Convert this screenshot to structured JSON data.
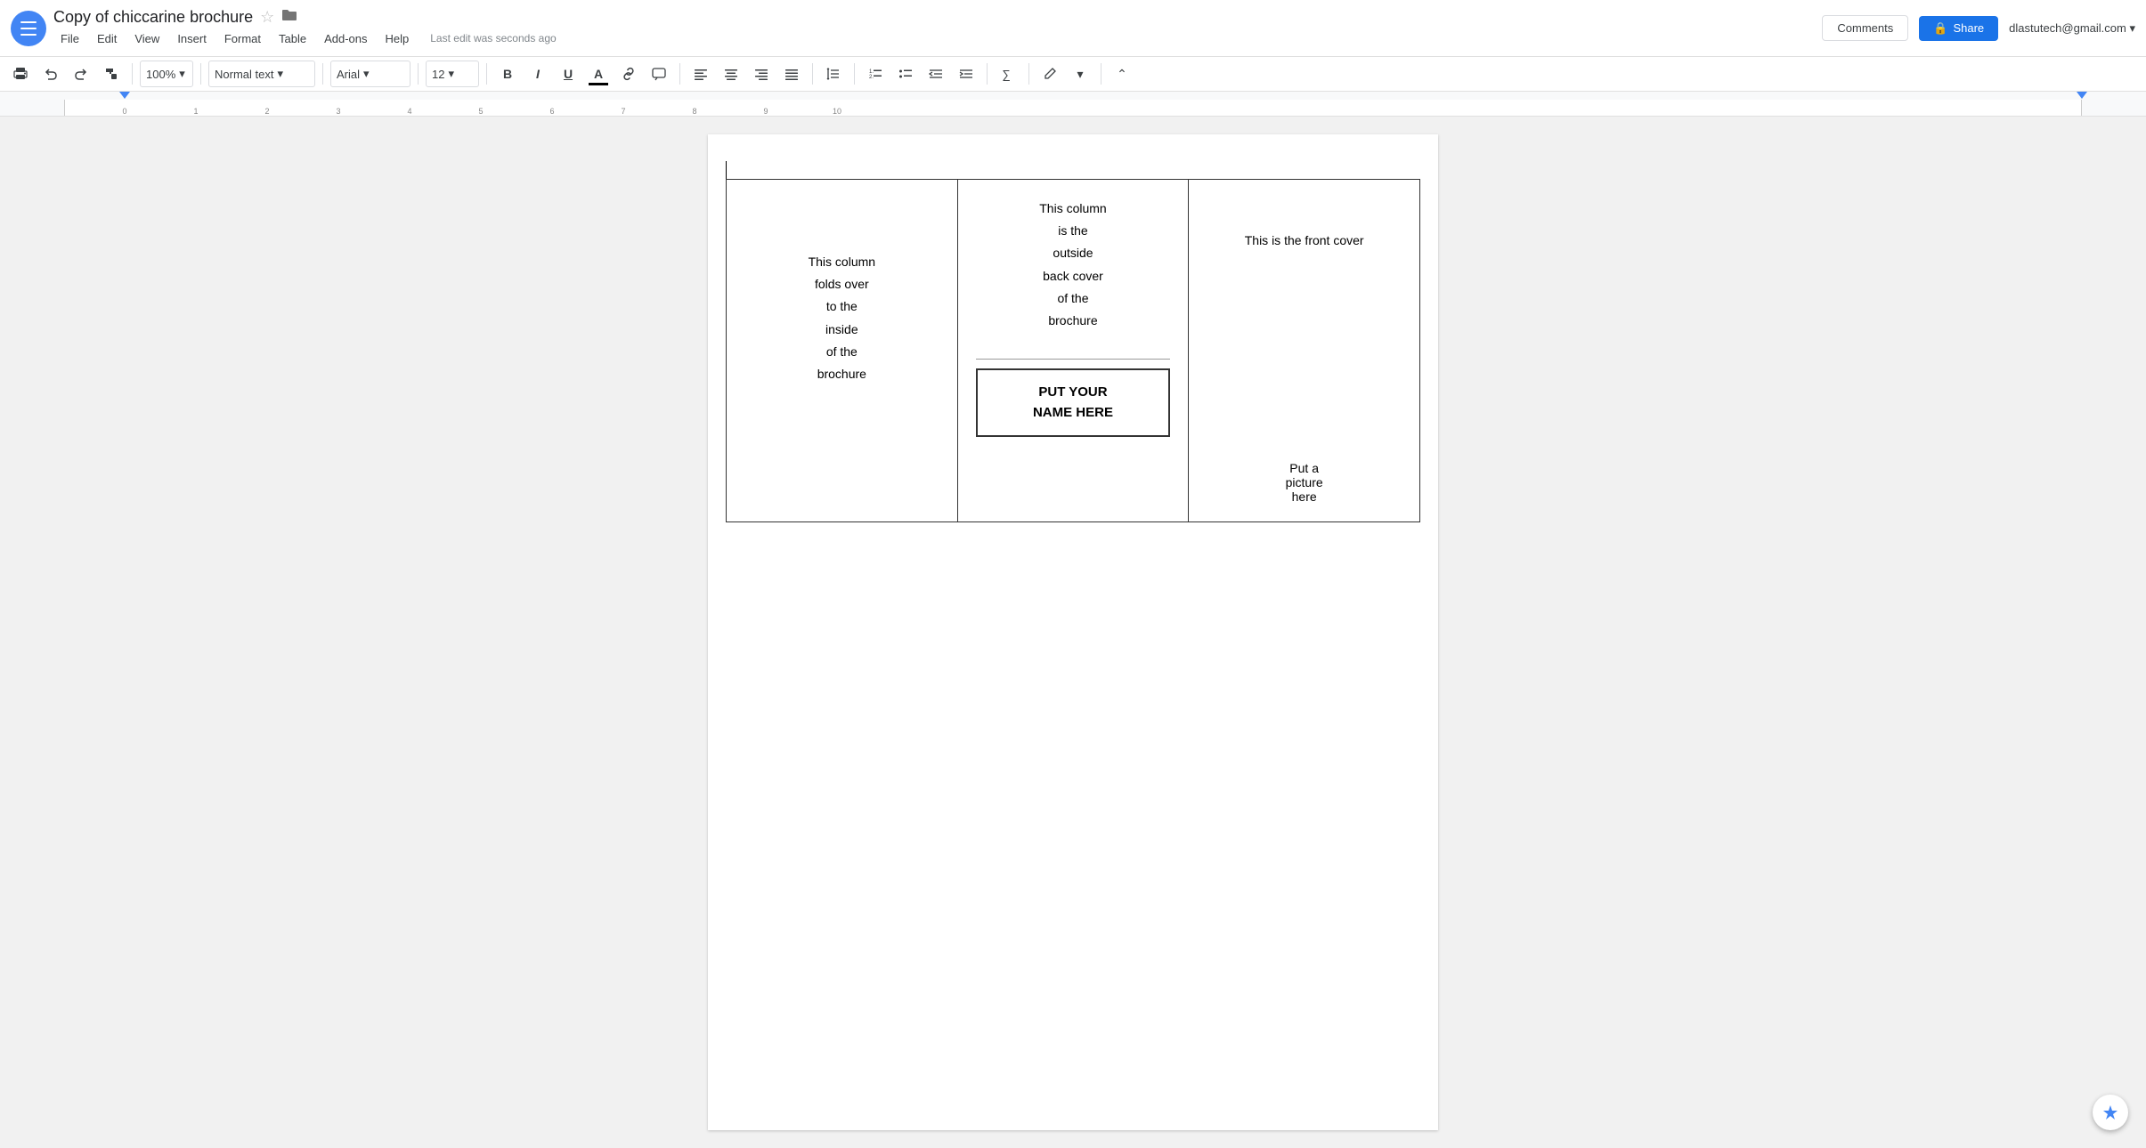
{
  "app": {
    "hamburger_label": "Main menu"
  },
  "topbar": {
    "title": "Copy of chiccarine brochure",
    "star_icon": "☆",
    "folder_icon": "▬",
    "menus": [
      "File",
      "Edit",
      "View",
      "Insert",
      "Format",
      "Table",
      "Add-ons",
      "Help"
    ],
    "last_edit": "Last edit was seconds ago",
    "comments_label": "Comments",
    "share_icon": "🔒",
    "share_label": "Share",
    "user_email": "dlastutech@gmail.com",
    "user_dropdown": "▾"
  },
  "toolbar": {
    "print_icon": "🖨",
    "undo_icon": "↩",
    "redo_icon": "↪",
    "paint_icon": "🖌",
    "zoom_value": "100%",
    "zoom_dropdown": "▾",
    "font_style": "Normal text",
    "font_style_dropdown": "▾",
    "font_name": "Arial",
    "font_name_dropdown": "▾",
    "font_size": "12",
    "font_size_dropdown": "▾",
    "bold": "B",
    "italic": "I",
    "underline": "U",
    "text_color": "A",
    "link_icon": "🔗",
    "comment_icon": "💬",
    "align_left": "≡",
    "align_center": "≡",
    "align_right": "≡",
    "align_justify": "≡",
    "line_spacing": "↕",
    "numbered_list": "☰",
    "bulleted_list": "☰",
    "decrease_indent": "⇤",
    "increase_indent": "⇥",
    "formula": "∑",
    "pen_icon": "✏",
    "collapse_icon": "⌃"
  },
  "document": {
    "col1_text": "This column\nfolds over\nto the\ninside\nof the\nbrochure",
    "col2_top_text": "This column\nis the\noutside\nback cover\nof the\nbrochure",
    "col2_name_line1": "PUT YOUR",
    "col2_name_line2": "NAME HERE",
    "col3_front_cover": "This is the front cover",
    "col3_picture": "Put a\npicture\nhere"
  }
}
